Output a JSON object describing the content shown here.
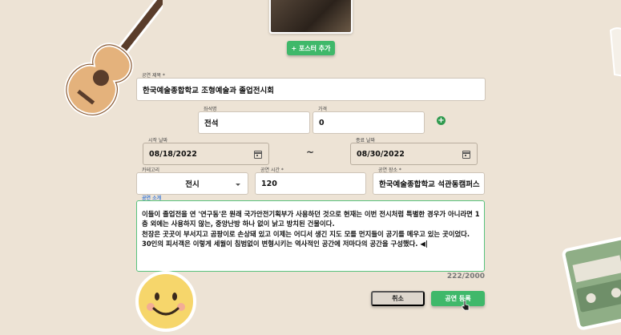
{
  "poster": {
    "add_button_label": "+ 포스터 추가"
  },
  "form": {
    "title": {
      "label": "공연 제목 *",
      "value": "한국예술종합학교 조형예술과 졸업전시회"
    },
    "seat": {
      "label": "좌석명",
      "value": "전석"
    },
    "price": {
      "label": "가격",
      "value": "0"
    },
    "start_date": {
      "label": "시작 날짜",
      "value": "08/18/2022"
    },
    "date_separator": "~",
    "end_date": {
      "label": "종료 날짜",
      "value": "08/30/2022"
    },
    "category": {
      "label": "카테고리",
      "value": "전시"
    },
    "runtime": {
      "label": "공연 시간 *",
      "value": "120"
    },
    "place": {
      "label": "공연 장소 *",
      "value": "한국예술종합학교 석관동캠퍼스 미술원"
    },
    "description": {
      "label": "공연 소개",
      "lines": [
        "이들이 졸업전을 연 '연구동'은 원래 국가안전기획부가 사용하던 것으로 현재는 이번 전시처럼 특별한 경우가 아니라면 1",
        "층 외에는 사용하지 않는, 중앙난방 하나 없이 낡고 방치된 건물이다.",
        "천장은 곳곳이 부서지고 곰팡이로 손상돼 있고 이제는 어디서 생긴 지도 모를 먼지들이 공기를 메우고 있는 곳이었다.",
        "30인의 피서객은 이렇게 세월이 침범없이 변형시키는 역사적인 공간에 저마다의 공간을 구성했다.  ◀|"
      ],
      "counter": "222/2000"
    }
  },
  "actions": {
    "cancel_label": "취소",
    "submit_label": "공연 등록"
  },
  "colors": {
    "background": "#ede3d5",
    "accent_green": "#3fb86a",
    "focus_border": "#58c27d"
  }
}
